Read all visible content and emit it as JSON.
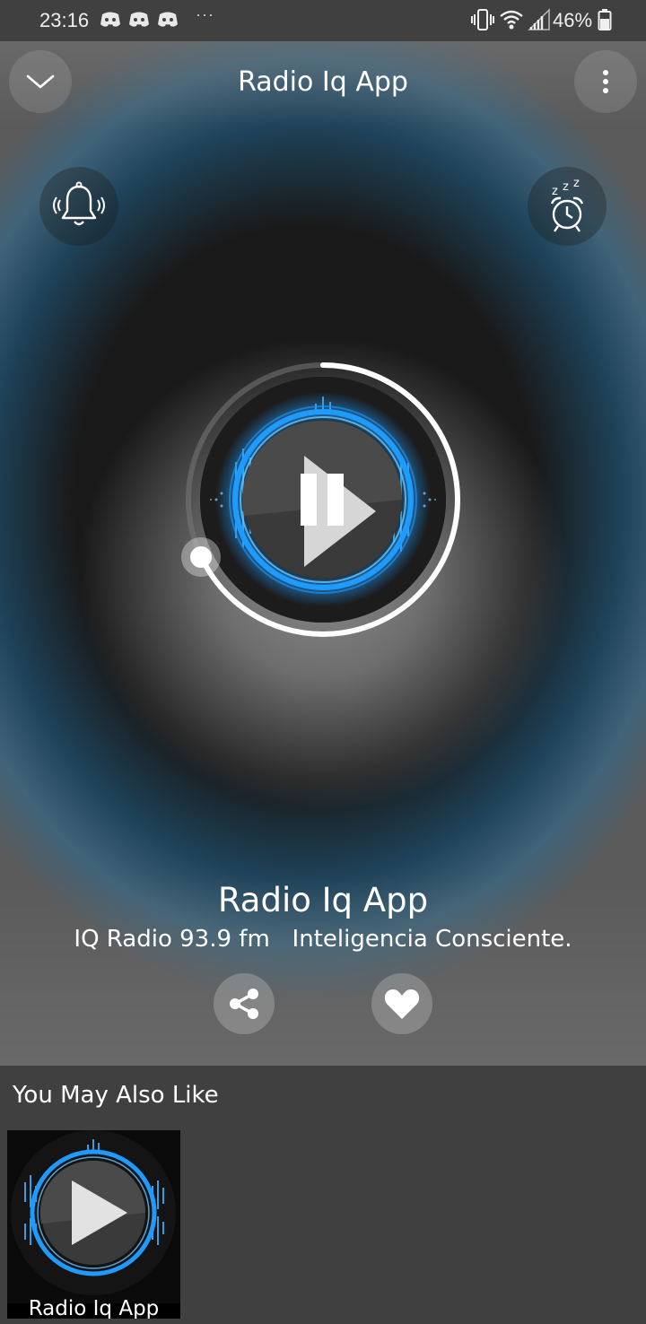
{
  "status_bar": {
    "time": "23:16",
    "overflow": "···",
    "battery": "46%",
    "notification_icons": [
      "discord-icon",
      "discord-icon",
      "discord-icon"
    ],
    "system_icons": [
      "vibrate-icon",
      "wifi-icon",
      "signal-icon",
      "battery-icon"
    ]
  },
  "header": {
    "title": "Radio Iq App",
    "collapse_icon": "chevron-down-icon",
    "menu_icon": "more-vert-icon"
  },
  "controls": {
    "alarm_icon": "bell-ringing-icon",
    "sleep_icon": "sleep-timer-icon",
    "play_state_icon": "pause-icon",
    "progress": 0.68
  },
  "now_playing": {
    "name": "Radio Iq App",
    "subtitle": "IQ Radio 93.9 fm   Inteligencia Consciente."
  },
  "actions": {
    "share_icon": "share-icon",
    "favorite_icon": "heart-icon"
  },
  "suggestions": {
    "title": "You May Also Like",
    "items": [
      {
        "label": "Radio Iq App"
      }
    ]
  },
  "colors": {
    "accent_blue": "#1e9bff",
    "background": "#404040",
    "text": "#ffffff"
  }
}
